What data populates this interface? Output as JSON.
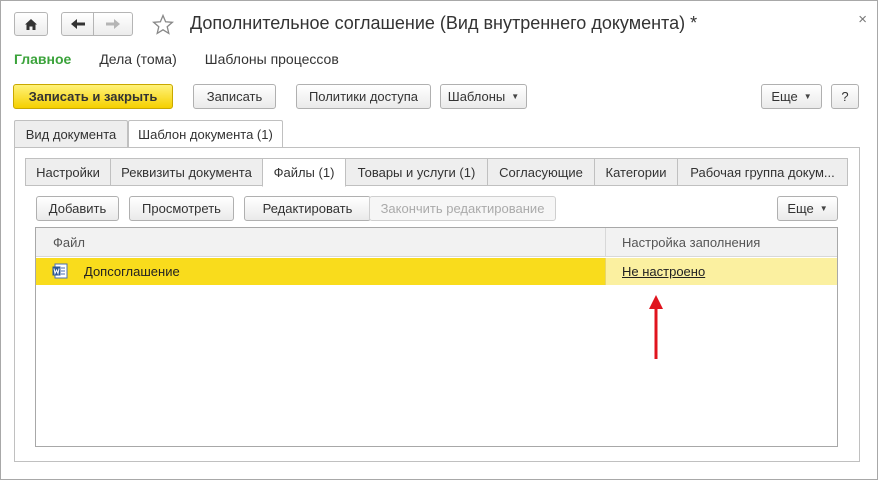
{
  "window": {
    "title": "Дополнительное соглашение (Вид внутреннего документа) *",
    "close_glyph": "×"
  },
  "nav": {
    "main": "Главное",
    "cases": "Дела (тома)",
    "templates": "Шаблоны процессов"
  },
  "toolbar": {
    "save_close": "Записать и закрыть",
    "save": "Записать",
    "access_policies": "Политики доступа",
    "templates": "Шаблоны",
    "more": "Еще",
    "help": "?"
  },
  "outer_tabs": [
    "Вид документа",
    "Шаблон документа (1)"
  ],
  "inner_tabs": [
    "Настройки",
    "Реквизиты документа",
    "Файлы (1)",
    "Товары и услуги (1)",
    "Согласующие",
    "Категории",
    "Рабочая группа докум..."
  ],
  "files_toolbar": {
    "add": "Добавить",
    "view": "Просмотреть",
    "edit": "Редактировать",
    "finish_edit": "Закончить редактирование",
    "more": "Еще"
  },
  "table": {
    "columns": [
      "Файл",
      "Настройка заполнения"
    ],
    "rows": [
      {
        "file": "Допсоглашение",
        "setting": "Не настроено"
      }
    ]
  },
  "icons": {
    "home": "home-icon",
    "back": "arrow-left-icon",
    "forward": "arrow-right-icon",
    "favorite": "star-icon",
    "close": "close-icon",
    "word": "word-document-icon",
    "annotation": "red-arrow-icon"
  },
  "colors": {
    "primary_button": "#f5d000",
    "selected_row": "#f9dc1c",
    "active_nav": "#3ba33b",
    "annotation_arrow": "#e0141e"
  }
}
